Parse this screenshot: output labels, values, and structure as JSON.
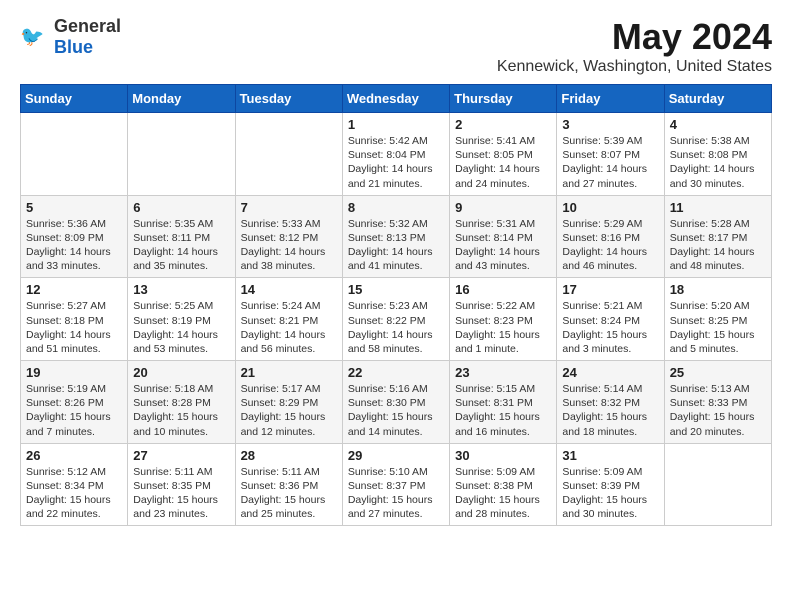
{
  "header": {
    "logo_general": "General",
    "logo_blue": "Blue",
    "month_title": "May 2024",
    "location": "Kennewick, Washington, United States"
  },
  "days_of_week": [
    "Sunday",
    "Monday",
    "Tuesday",
    "Wednesday",
    "Thursday",
    "Friday",
    "Saturday"
  ],
  "weeks": [
    [
      {
        "day": "",
        "info": ""
      },
      {
        "day": "",
        "info": ""
      },
      {
        "day": "",
        "info": ""
      },
      {
        "day": "1",
        "info": "Sunrise: 5:42 AM\nSunset: 8:04 PM\nDaylight: 14 hours\nand 21 minutes."
      },
      {
        "day": "2",
        "info": "Sunrise: 5:41 AM\nSunset: 8:05 PM\nDaylight: 14 hours\nand 24 minutes."
      },
      {
        "day": "3",
        "info": "Sunrise: 5:39 AM\nSunset: 8:07 PM\nDaylight: 14 hours\nand 27 minutes."
      },
      {
        "day": "4",
        "info": "Sunrise: 5:38 AM\nSunset: 8:08 PM\nDaylight: 14 hours\nand 30 minutes."
      }
    ],
    [
      {
        "day": "5",
        "info": "Sunrise: 5:36 AM\nSunset: 8:09 PM\nDaylight: 14 hours\nand 33 minutes."
      },
      {
        "day": "6",
        "info": "Sunrise: 5:35 AM\nSunset: 8:11 PM\nDaylight: 14 hours\nand 35 minutes."
      },
      {
        "day": "7",
        "info": "Sunrise: 5:33 AM\nSunset: 8:12 PM\nDaylight: 14 hours\nand 38 minutes."
      },
      {
        "day": "8",
        "info": "Sunrise: 5:32 AM\nSunset: 8:13 PM\nDaylight: 14 hours\nand 41 minutes."
      },
      {
        "day": "9",
        "info": "Sunrise: 5:31 AM\nSunset: 8:14 PM\nDaylight: 14 hours\nand 43 minutes."
      },
      {
        "day": "10",
        "info": "Sunrise: 5:29 AM\nSunset: 8:16 PM\nDaylight: 14 hours\nand 46 minutes."
      },
      {
        "day": "11",
        "info": "Sunrise: 5:28 AM\nSunset: 8:17 PM\nDaylight: 14 hours\nand 48 minutes."
      }
    ],
    [
      {
        "day": "12",
        "info": "Sunrise: 5:27 AM\nSunset: 8:18 PM\nDaylight: 14 hours\nand 51 minutes."
      },
      {
        "day": "13",
        "info": "Sunrise: 5:25 AM\nSunset: 8:19 PM\nDaylight: 14 hours\nand 53 minutes."
      },
      {
        "day": "14",
        "info": "Sunrise: 5:24 AM\nSunset: 8:21 PM\nDaylight: 14 hours\nand 56 minutes."
      },
      {
        "day": "15",
        "info": "Sunrise: 5:23 AM\nSunset: 8:22 PM\nDaylight: 14 hours\nand 58 minutes."
      },
      {
        "day": "16",
        "info": "Sunrise: 5:22 AM\nSunset: 8:23 PM\nDaylight: 15 hours\nand 1 minute."
      },
      {
        "day": "17",
        "info": "Sunrise: 5:21 AM\nSunset: 8:24 PM\nDaylight: 15 hours\nand 3 minutes."
      },
      {
        "day": "18",
        "info": "Sunrise: 5:20 AM\nSunset: 8:25 PM\nDaylight: 15 hours\nand 5 minutes."
      }
    ],
    [
      {
        "day": "19",
        "info": "Sunrise: 5:19 AM\nSunset: 8:26 PM\nDaylight: 15 hours\nand 7 minutes."
      },
      {
        "day": "20",
        "info": "Sunrise: 5:18 AM\nSunset: 8:28 PM\nDaylight: 15 hours\nand 10 minutes."
      },
      {
        "day": "21",
        "info": "Sunrise: 5:17 AM\nSunset: 8:29 PM\nDaylight: 15 hours\nand 12 minutes."
      },
      {
        "day": "22",
        "info": "Sunrise: 5:16 AM\nSunset: 8:30 PM\nDaylight: 15 hours\nand 14 minutes."
      },
      {
        "day": "23",
        "info": "Sunrise: 5:15 AM\nSunset: 8:31 PM\nDaylight: 15 hours\nand 16 minutes."
      },
      {
        "day": "24",
        "info": "Sunrise: 5:14 AM\nSunset: 8:32 PM\nDaylight: 15 hours\nand 18 minutes."
      },
      {
        "day": "25",
        "info": "Sunrise: 5:13 AM\nSunset: 8:33 PM\nDaylight: 15 hours\nand 20 minutes."
      }
    ],
    [
      {
        "day": "26",
        "info": "Sunrise: 5:12 AM\nSunset: 8:34 PM\nDaylight: 15 hours\nand 22 minutes."
      },
      {
        "day": "27",
        "info": "Sunrise: 5:11 AM\nSunset: 8:35 PM\nDaylight: 15 hours\nand 23 minutes."
      },
      {
        "day": "28",
        "info": "Sunrise: 5:11 AM\nSunset: 8:36 PM\nDaylight: 15 hours\nand 25 minutes."
      },
      {
        "day": "29",
        "info": "Sunrise: 5:10 AM\nSunset: 8:37 PM\nDaylight: 15 hours\nand 27 minutes."
      },
      {
        "day": "30",
        "info": "Sunrise: 5:09 AM\nSunset: 8:38 PM\nDaylight: 15 hours\nand 28 minutes."
      },
      {
        "day": "31",
        "info": "Sunrise: 5:09 AM\nSunset: 8:39 PM\nDaylight: 15 hours\nand 30 minutes."
      },
      {
        "day": "",
        "info": ""
      }
    ]
  ]
}
